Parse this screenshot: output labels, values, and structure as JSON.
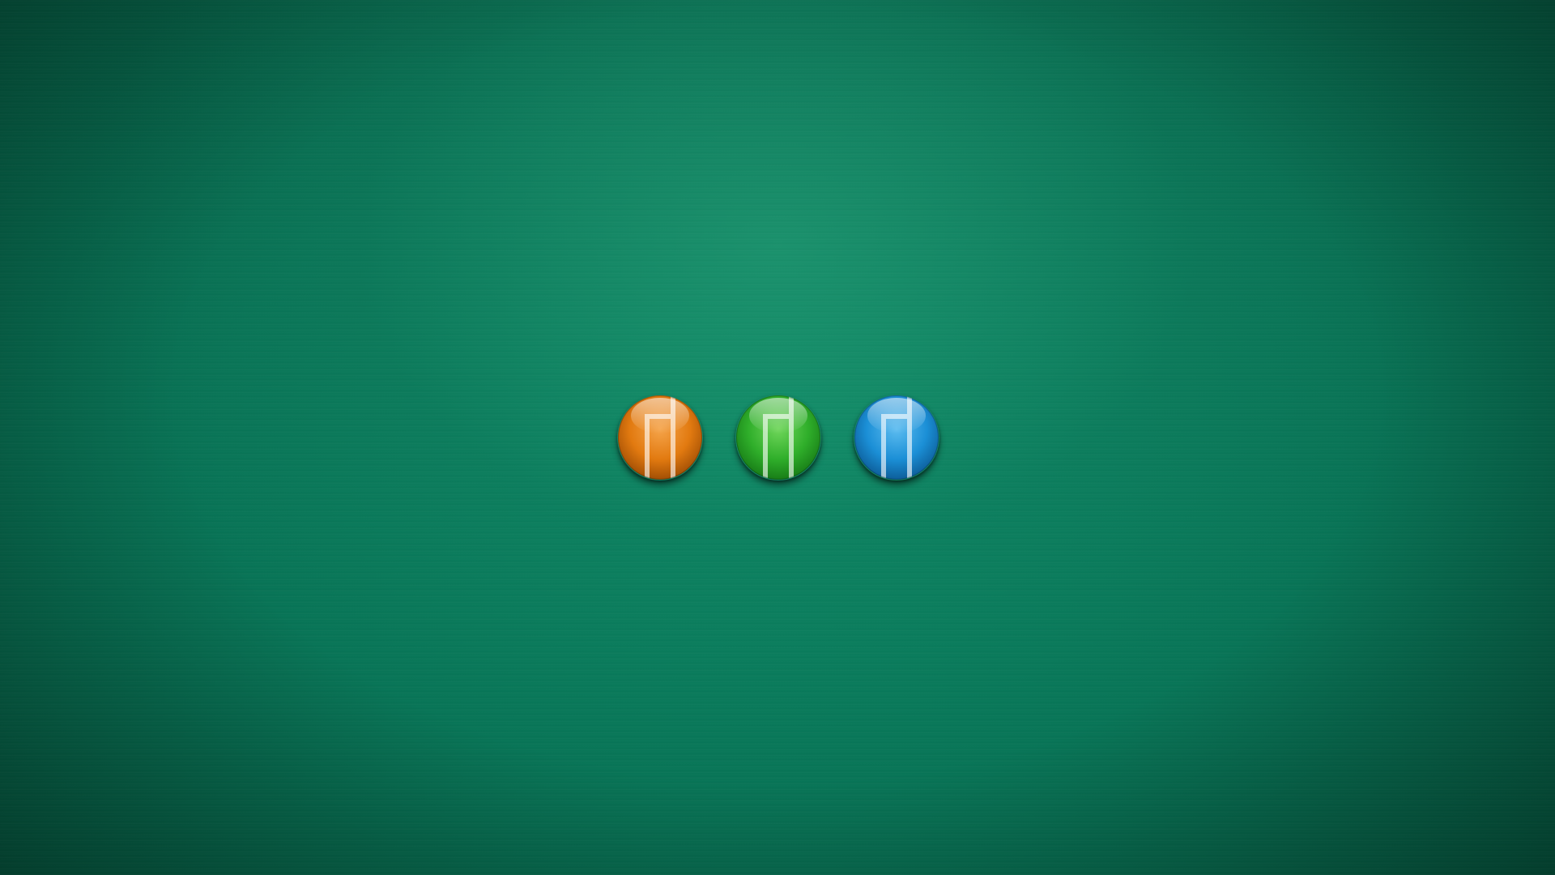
{
  "desktop": {
    "wallpaper": "brushed-green-gradient",
    "base_color": "#087456",
    "logos": [
      {
        "name": "mandriva-logo-orange",
        "icon": "mandriva-icon",
        "color": "#e27a10",
        "color_light": "#f5a44a",
        "color_dark": "#a24f05"
      },
      {
        "name": "mandriva-logo-green",
        "icon": "mandriva-icon",
        "color": "#2fae2a",
        "color_light": "#6fd65a",
        "color_dark": "#187d17"
      },
      {
        "name": "mandriva-logo-blue",
        "icon": "mandriva-icon",
        "color": "#1b8fd6",
        "color_light": "#5cbcf0",
        "color_dark": "#0d5e9a"
      }
    ]
  }
}
